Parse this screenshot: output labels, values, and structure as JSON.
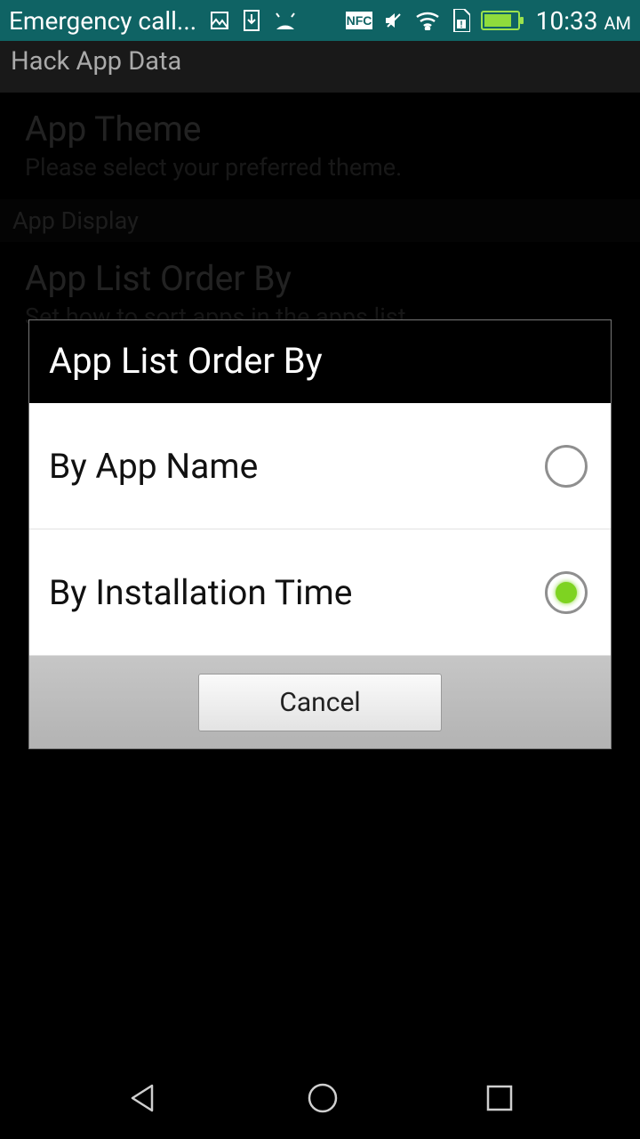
{
  "status": {
    "left_text": "Emergency call...",
    "time": "10:33",
    "ampm": "AM"
  },
  "action_bar": {
    "title": "Hack App Data"
  },
  "settings": {
    "theme_title": "App Theme",
    "theme_sub": "Please select your preferred theme.",
    "section_display": "App Display",
    "order_title": "App List Order By",
    "order_sub": "Set how to sort apps in the apps list."
  },
  "dialog": {
    "title": "App List Order By",
    "options": [
      {
        "label": "By App Name",
        "selected": false
      },
      {
        "label": "By Installation Time",
        "selected": true
      }
    ],
    "cancel": "Cancel"
  }
}
